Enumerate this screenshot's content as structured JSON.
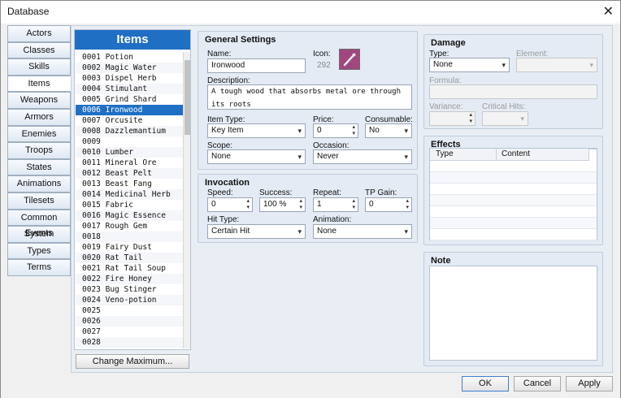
{
  "window": {
    "title": "Database"
  },
  "nav": {
    "items": [
      {
        "label": "Actors"
      },
      {
        "label": "Classes"
      },
      {
        "label": "Skills"
      },
      {
        "label": "Items",
        "active": true
      },
      {
        "label": "Weapons"
      },
      {
        "label": "Armors"
      },
      {
        "label": "Enemies"
      },
      {
        "label": "Troops"
      },
      {
        "label": "States"
      },
      {
        "label": "Animations"
      },
      {
        "label": "Tilesets"
      },
      {
        "label": "Common Events"
      },
      {
        "label": "System"
      },
      {
        "label": "Types"
      },
      {
        "label": "Terms"
      }
    ]
  },
  "list": {
    "title": "Items",
    "items": [
      "0001 Potion",
      "0002 Magic Water",
      "0003 Dispel Herb",
      "0004 Stimulant",
      "0005 Grind Shard",
      "0006 Ironwood",
      "0007 Orcusite",
      "0008 Dazzlemantium",
      "0009",
      "0010 Lumber",
      "0011 Mineral Ore",
      "0012 Beast Pelt",
      "0013 Beast Fang",
      "0014 Medicinal Herb",
      "0015 Fabric",
      "0016 Magic Essence",
      "0017 Rough Gem",
      "0018",
      "0019 Fairy Dust",
      "0020 Rat Tail",
      "0021 Rat Tail Soup",
      "0022 Fire Honey",
      "0023 Bug Stinger",
      "0024 Veno-potion",
      "0025",
      "0026",
      "0027",
      "0028"
    ],
    "selected_index": 5,
    "change_max_label": "Change Maximum..."
  },
  "general": {
    "title": "General Settings",
    "name_label": "Name:",
    "name_value": "Ironwood",
    "icon_label": "Icon:",
    "icon_index": "292",
    "description_label": "Description:",
    "description_value": "A tough wood that absorbs metal ore through its roots",
    "item_type_label": "Item Type:",
    "item_type_value": "Key Item",
    "price_label": "Price:",
    "price_value": "0",
    "consumable_label": "Consumable:",
    "consumable_value": "No",
    "scope_label": "Scope:",
    "scope_value": "None",
    "occasion_label": "Occasion:",
    "occasion_value": "Never"
  },
  "invocation": {
    "title": "Invocation",
    "speed_label": "Speed:",
    "speed_value": "0",
    "success_label": "Success:",
    "success_value": "100 %",
    "repeat_label": "Repeat:",
    "repeat_value": "1",
    "tp_label": "TP Gain:",
    "tp_value": "0",
    "hit_type_label": "Hit Type:",
    "hit_type_value": "Certain Hit",
    "animation_label": "Animation:",
    "animation_value": "None"
  },
  "damage": {
    "title": "Damage",
    "type_label": "Type:",
    "type_value": "None",
    "element_label": "Element:",
    "element_value": "",
    "formula_label": "Formula:",
    "variance_label": "Variance:",
    "critical_label": "Critical Hits:"
  },
  "effects": {
    "title": "Effects",
    "col_type": "Type",
    "col_content": "Content"
  },
  "note": {
    "title": "Note"
  },
  "footer": {
    "ok": "OK",
    "cancel": "Cancel",
    "apply": "Apply"
  },
  "colors": {
    "accent": "#1f6fc5",
    "icon_bg": "#a0477f"
  }
}
